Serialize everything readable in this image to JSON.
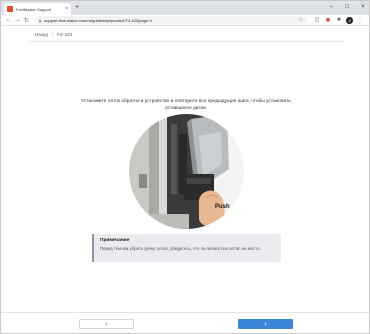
{
  "browser": {
    "tab_title": "FoldMaster Support",
    "tab_close": "×",
    "new_tab": "+",
    "window_controls": [
      "–",
      "□",
      "×"
    ],
    "url": "support.tera-maker.com/ru/guide/repl/product-F4-423/page-9"
  },
  "breadcrumb": {
    "back": "Назад",
    "separator": "/",
    "current": "F4–423"
  },
  "instruction": "Установите лоток обратно в устройство и повторите все предыдущие шаги, чтобы установить оставшиеся диски.",
  "illustration": {
    "push_label": "Push"
  },
  "note": {
    "title": "Примечание",
    "text": "Перед тем как убрать ручку лотка, убедитесь, что он полностью встал на место."
  },
  "buttons": {
    "back": "‹",
    "next": "›"
  },
  "icons": {
    "back": "arrow-left-icon",
    "forward": "arrow-right-icon",
    "reload": "reload-icon",
    "lock": "lock-icon",
    "star": "star-icon",
    "profile": "profile-icon"
  },
  "colors": {
    "primary": "#3b86d8",
    "note_bg": "#e9ebee"
  }
}
